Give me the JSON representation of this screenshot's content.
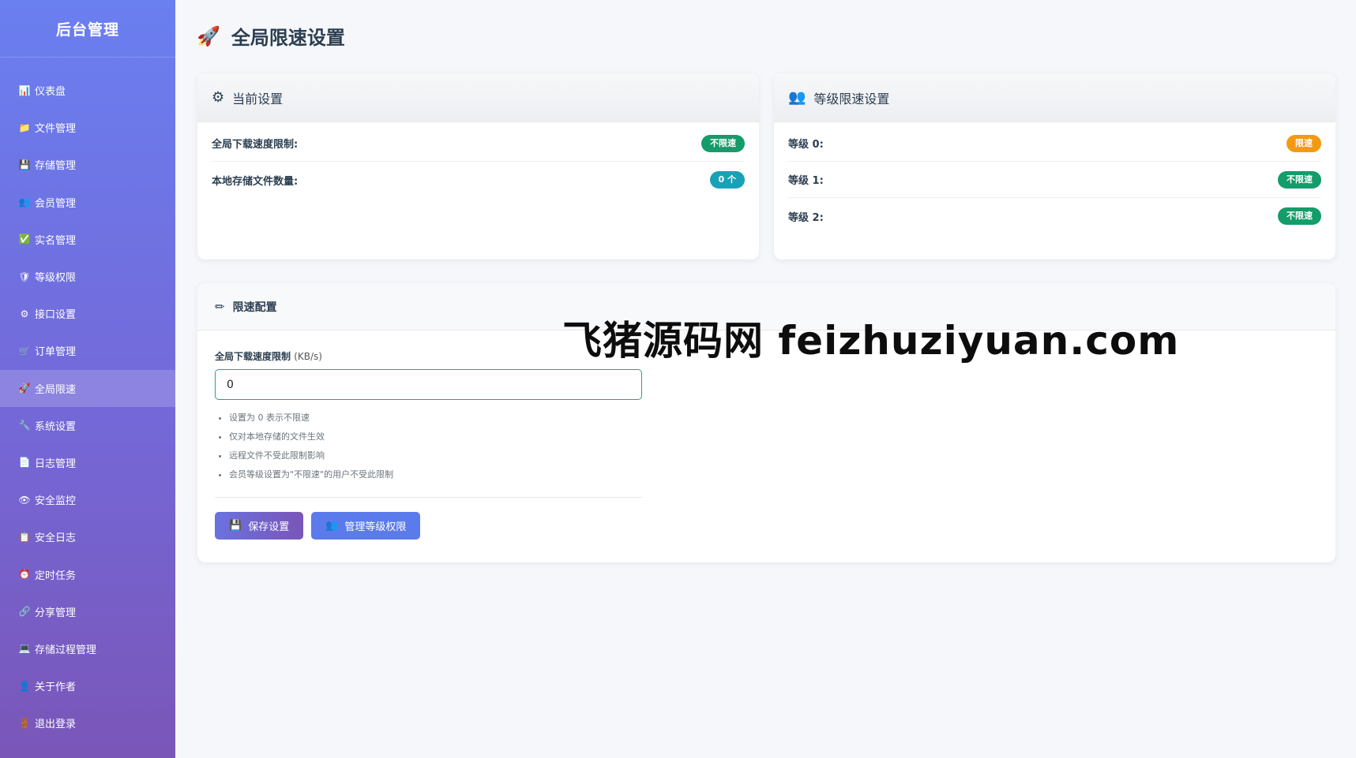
{
  "sidebar": {
    "brand": "后台管理",
    "items": [
      {
        "icon": "📊",
        "label": "仪表盘"
      },
      {
        "icon": "📁",
        "label": "文件管理"
      },
      {
        "icon": "💾",
        "label": "存储管理"
      },
      {
        "icon": "👥",
        "label": "会员管理"
      },
      {
        "icon": "✅",
        "label": "实名管理"
      },
      {
        "icon": "🛡",
        "label": "等级权限"
      },
      {
        "icon": "⚙",
        "label": "接口设置"
      },
      {
        "icon": "🛒",
        "label": "订单管理"
      },
      {
        "icon": "🚀",
        "label": "全局限速"
      },
      {
        "icon": "🔧",
        "label": "系统设置"
      },
      {
        "icon": "📄",
        "label": "日志管理"
      },
      {
        "icon": "👁",
        "label": "安全监控"
      },
      {
        "icon": "📋",
        "label": "安全日志"
      },
      {
        "icon": "⏰",
        "label": "定时任务"
      },
      {
        "icon": "🔗",
        "label": "分享管理"
      },
      {
        "icon": "💻",
        "label": "存储过程管理"
      },
      {
        "icon": "👤",
        "label": "关于作者"
      },
      {
        "icon": "🚪",
        "label": "退出登录"
      }
    ]
  },
  "page": {
    "icon": "🚀",
    "title": "全局限速设置"
  },
  "current_settings": {
    "icon": "⚙",
    "title": "当前设置",
    "rows": [
      {
        "label": "全局下载速度限制:",
        "value": "不限速",
        "color": "#149c6a"
      },
      {
        "label": "本地存储文件数量:",
        "value": "0 个",
        "color": "#17a2b8"
      }
    ]
  },
  "level_settings": {
    "icon": "👥",
    "title": "等级限速设置",
    "rows": [
      {
        "label": "等级 0:",
        "value": "限速",
        "color": "#f39a12"
      },
      {
        "label": "等级 1:",
        "value": "不限速",
        "color": "#149c6a"
      },
      {
        "label": "等级 2:",
        "value": "不限速",
        "color": "#149c6a"
      }
    ]
  },
  "config": {
    "icon": "✏",
    "title": "限速配置",
    "field_label": "全局下载速度限制",
    "field_unit": "(KB/s)",
    "field_value": "0",
    "hints": [
      "设置为 0 表示不限速",
      "仅对本地存储的文件生效",
      "远程文件不受此限制影响",
      "会员等级设置为\"不限速\"的用户不受此限制"
    ],
    "save_icon": "💾",
    "save_label": "保存设置",
    "manage_icon": "👥",
    "manage_label": "管理等级权限"
  },
  "watermark": "飞猪源码网 feizhuziyuan.com"
}
